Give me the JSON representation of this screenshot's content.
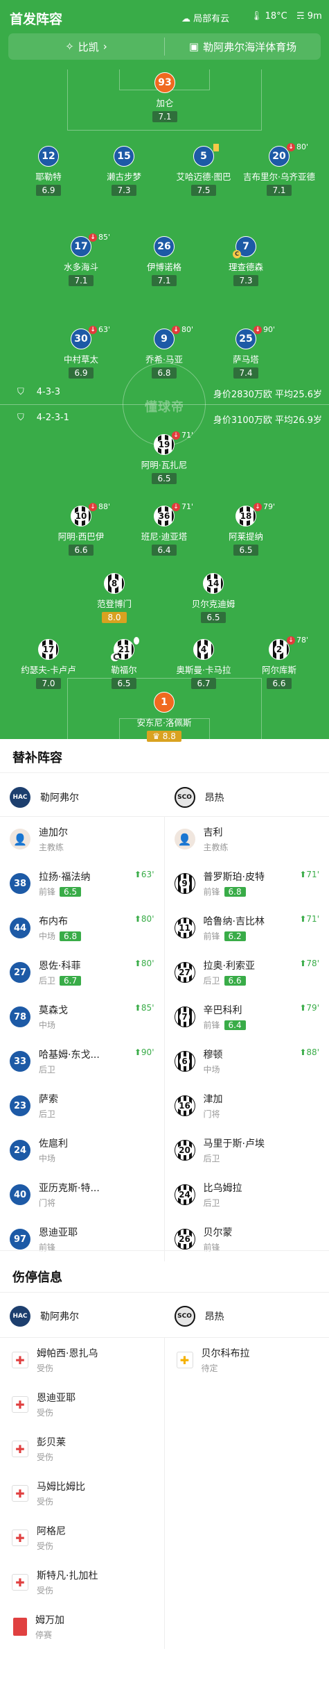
{
  "header": {
    "title": "首发阵容",
    "weather": "局部有云",
    "temp": "18°C",
    "wind": "9m"
  },
  "teambar": {
    "referee": "比凯",
    "stadium": "勒阿弗尔海洋体育场"
  },
  "formation_home": {
    "formation": "4-3-3",
    "value": "身价2830万欧 平均25.6岁"
  },
  "formation_away": {
    "formation": "4-2-3-1",
    "value": "身价3100万欧 平均26.9岁"
  },
  "watermark": "懂球帝",
  "home_players": [
    {
      "num": "93",
      "name": "加仑",
      "rating": "7.1"
    },
    {
      "num": "12",
      "name": "耶勒特",
      "rating": "6.9"
    },
    {
      "num": "15",
      "name": "濑古步梦",
      "rating": "7.3"
    },
    {
      "num": "5",
      "name": "艾哈迈德·图巴",
      "rating": "7.5"
    },
    {
      "num": "20",
      "name": "吉布里尔·乌齐亚德",
      "rating": "7.1",
      "sub": "80'"
    },
    {
      "num": "17",
      "name": "水多海斗",
      "rating": "7.1",
      "sub": "85'"
    },
    {
      "num": "26",
      "name": "伊博诺格",
      "rating": "7.1"
    },
    {
      "num": "7",
      "name": "理查德森",
      "rating": "7.3"
    },
    {
      "num": "30",
      "name": "中村草太",
      "rating": "6.9",
      "sub": "63'"
    },
    {
      "num": "9",
      "name": "乔希·马亚",
      "rating": "6.8",
      "sub": "80'"
    },
    {
      "num": "25",
      "name": "萨马塔",
      "rating": "7.4",
      "sub": "90'"
    }
  ],
  "away_players": [
    {
      "num": "19",
      "name": "阿明·瓦扎尼",
      "rating": "6.5",
      "sub": "71'"
    },
    {
      "num": "10",
      "name": "阿明·西巴伊",
      "rating": "6.6",
      "sub": "88'"
    },
    {
      "num": "36",
      "name": "班尼·迪亚塔",
      "rating": "6.4",
      "sub": "71'"
    },
    {
      "num": "18",
      "name": "阿莱提纳",
      "rating": "6.5",
      "sub": "79'"
    },
    {
      "num": "8",
      "name": "范登博门",
      "rating": "8.0"
    },
    {
      "num": "14",
      "name": "贝尔克迪姆",
      "rating": "6.5"
    },
    {
      "num": "17",
      "name": "约瑟夫-卡卢卢",
      "rating": "7.0"
    },
    {
      "num": "21",
      "name": "勒福尔",
      "rating": "6.5"
    },
    {
      "num": "4",
      "name": "奥斯曼·卡马拉",
      "rating": "6.7"
    },
    {
      "num": "2",
      "name": "阿尔库斯",
      "rating": "6.6",
      "sub": "78'"
    },
    {
      "num": "1",
      "name": "安东尼·洛佩斯",
      "rating": "8.8"
    }
  ],
  "subs_title": "替补阵容",
  "home_team": "勒阿弗尔",
  "away_team": "昂热",
  "home_coach": {
    "name": "迪加尔",
    "role": "主教练"
  },
  "away_coach": {
    "name": "吉利",
    "role": "主教练"
  },
  "subs": [
    {
      "num": "38",
      "name": "拉扬·福法纳",
      "pos": "前锋",
      "rating": "6.5",
      "time": "63'"
    },
    {
      "num": "9",
      "name": "普罗斯珀·皮特",
      "pos": "前锋",
      "rating": "6.8",
      "time": "71'"
    },
    {
      "num": "44",
      "name": "布内布",
      "pos": "中场",
      "rating": "6.8",
      "time": "80'"
    },
    {
      "num": "11",
      "name": "哈鲁纳·吉比林",
      "pos": "前锋",
      "rating": "6.2",
      "time": "71'"
    },
    {
      "num": "27",
      "name": "恩佐·科菲",
      "pos": "后卫",
      "rating": "6.7",
      "time": "80'"
    },
    {
      "num": "27",
      "name": "拉奥·利索亚",
      "pos": "后卫",
      "rating": "6.6",
      "time": "78'"
    },
    {
      "num": "78",
      "name": "莫森戈",
      "pos": "中场",
      "rating": "",
      "time": "85'"
    },
    {
      "num": "7",
      "name": "辛巴科利",
      "pos": "前锋",
      "rating": "6.4",
      "time": "79'"
    },
    {
      "num": "33",
      "name": "哈基姆·东戈...",
      "pos": "后卫",
      "rating": "",
      "time": "90'"
    },
    {
      "num": "6",
      "name": "穆顿",
      "pos": "中场",
      "rating": "",
      "time": "88'"
    },
    {
      "num": "23",
      "name": "萨索",
      "pos": "后卫",
      "rating": "",
      "time": ""
    },
    {
      "num": "16",
      "name": "津加",
      "pos": "门将",
      "rating": "",
      "time": ""
    },
    {
      "num": "24",
      "name": "佐扈利",
      "pos": "中场",
      "rating": "",
      "time": ""
    },
    {
      "num": "20",
      "name": "马里于斯·卢埃",
      "pos": "后卫",
      "rating": "",
      "time": ""
    },
    {
      "num": "40",
      "name": "亚历克斯·特...",
      "pos": "门将",
      "rating": "",
      "time": ""
    },
    {
      "num": "24",
      "name": "比乌姆拉",
      "pos": "后卫",
      "rating": "",
      "time": ""
    },
    {
      "num": "97",
      "name": "恩迪亚耶",
      "pos": "前锋",
      "rating": "",
      "time": ""
    },
    {
      "num": "26",
      "name": "贝尔蒙",
      "pos": "前锋",
      "rating": "",
      "time": ""
    }
  ],
  "injury_title": "伤停信息",
  "injuries_home": [
    {
      "name": "姆帕西·恩扎乌",
      "status": "受伤"
    },
    {
      "name": "恩迪亚耶",
      "status": "受伤"
    },
    {
      "name": "彭贝莱",
      "status": "受伤"
    },
    {
      "name": "马姆比姆比",
      "status": "受伤"
    },
    {
      "name": "阿格尼",
      "status": "受伤"
    },
    {
      "name": "斯特凡·扎加杜",
      "status": "受伤"
    },
    {
      "name": "姆万加",
      "status": "停赛"
    }
  ],
  "injuries_away": [
    {
      "name": "贝尔科布拉",
      "status": "待定"
    }
  ],
  "colors": {
    "pitch": "#39ac48",
    "home": "#1d5aa6",
    "gk": "#f06a1f",
    "rating": "#2f6f3b",
    "highlight": "#d9a220"
  }
}
